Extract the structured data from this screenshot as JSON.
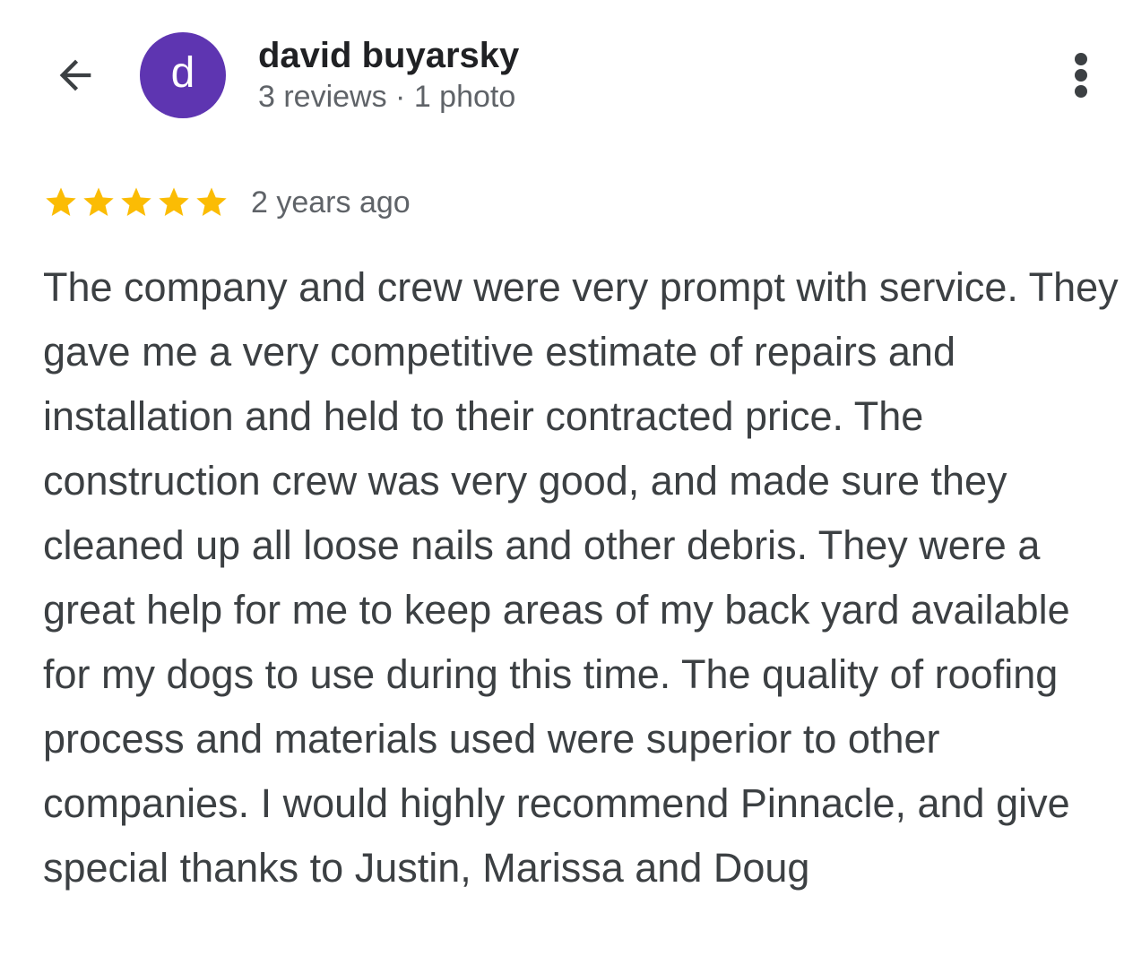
{
  "header": {
    "back_icon": "arrow-back-icon",
    "avatar_letter": "d",
    "avatar_color": "#5e35b1",
    "reviewer_name": "david buyarsky",
    "reviewer_meta": "3 reviews · 1 photo",
    "more_icon": "more-vertical-icon"
  },
  "review": {
    "rating": 5,
    "rating_max": 5,
    "star_color": "#fbbc04",
    "date": "2 years ago",
    "text": "The company and crew were very prompt with service. They gave me a very competitive estimate of repairs and installation and held to their contracted price. The construction crew was very good, and made sure they cleaned up all loose nails and other debris. They were a great help for me to keep areas of my back yard available for my dogs to use during this time. The quality of roofing process and materials used were superior to other companies. I would highly recommend Pinnacle, and give special thanks to Justin, Marissa and Doug"
  }
}
